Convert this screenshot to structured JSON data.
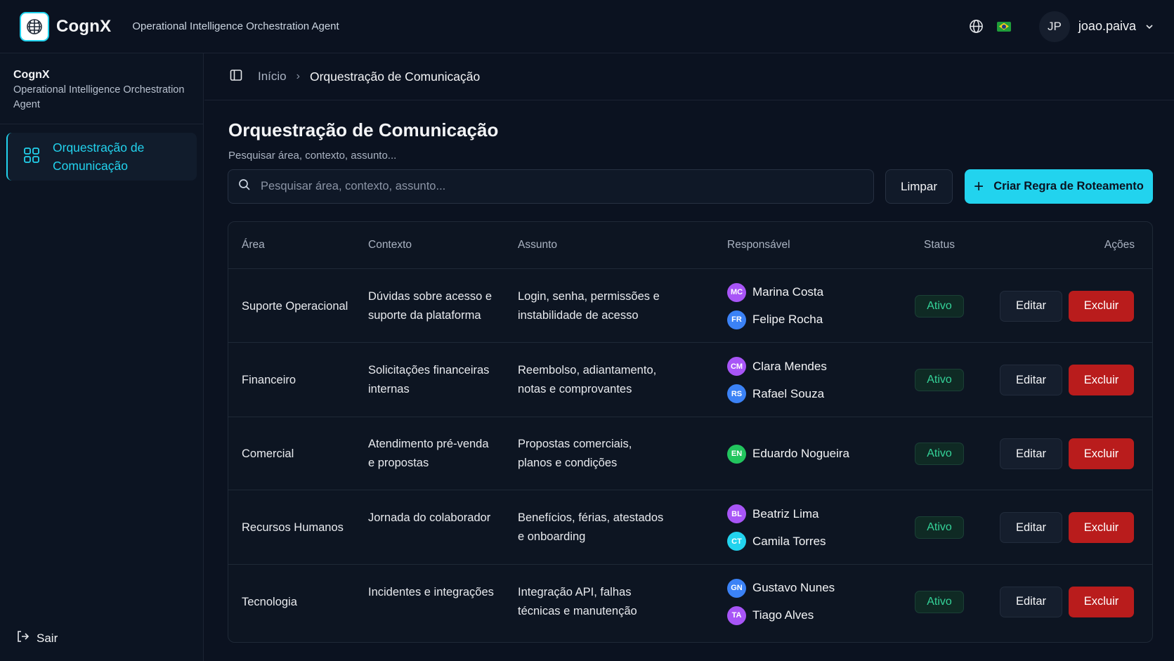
{
  "topbar": {
    "brand": "CognX",
    "tagline": "Operational Intelligence Orchestration Agent",
    "user_initials": "JP",
    "username": "joao.paiva"
  },
  "sidebar": {
    "title": "CognX",
    "subtitle": "Operational Intelligence Orchestration Agent",
    "items": [
      {
        "label": "Orquestração de Comunicação"
      }
    ],
    "logout_label": "Sair"
  },
  "breadcrumb": {
    "home": "Início",
    "current": "Orquestração de Comunicação"
  },
  "page": {
    "title": "Orquestração de Comunicação",
    "description": "Pesquisar área, contexto, assunto...",
    "search_placeholder": "Pesquisar área, contexto, assunto...",
    "clear_label": "Limpar",
    "create_label": "Criar Regra de Roteamento"
  },
  "table": {
    "headers": {
      "area": "Área",
      "context": "Contexto",
      "subject": "Assunto",
      "responsible": "Responsável",
      "status": "Status",
      "actions": "Ações"
    },
    "edit_label": "Editar",
    "delete_label": "Excluir",
    "rows": [
      {
        "area": "Suporte Operacional",
        "context": "Dúvidas sobre acesso e suporte da plataforma",
        "subject": "Login, senha, permissões e instabilidade de acesso",
        "people": [
          {
            "initials": "MC",
            "name": "Marina Costa",
            "color": "#a855f7"
          },
          {
            "initials": "FR",
            "name": "Felipe Rocha",
            "color": "#3b82f6"
          }
        ],
        "status": "Ativo"
      },
      {
        "area": "Financeiro",
        "context": "Solicitações financeiras internas",
        "subject": "Reembolso, adiantamento, notas e comprovantes",
        "people": [
          {
            "initials": "CM",
            "name": "Clara Mendes",
            "color": "#a855f7"
          },
          {
            "initials": "RS",
            "name": "Rafael Souza",
            "color": "#3b82f6"
          }
        ],
        "status": "Ativo"
      },
      {
        "area": "Comercial",
        "context": "Atendimento pré-venda e propostas",
        "subject": "Propostas comerciais, planos e condições",
        "people": [
          {
            "initials": "EN",
            "name": "Eduardo Nogueira",
            "color": "#22c55e"
          }
        ],
        "status": "Ativo"
      },
      {
        "area": "Recursos Humanos",
        "context": "Jornada do colaborador",
        "subject": "Benefícios, férias, atestados e onboarding",
        "people": [
          {
            "initials": "BL",
            "name": "Beatriz Lima",
            "color": "#a855f7"
          },
          {
            "initials": "CT",
            "name": "Camila Torres",
            "color": "#22d3ee"
          }
        ],
        "status": "Ativo"
      },
      {
        "area": "Tecnologia",
        "context": "Incidentes e integrações",
        "subject": "Integração API, falhas técnicas e manutenção",
        "people": [
          {
            "initials": "GN",
            "name": "Gustavo Nunes",
            "color": "#3b82f6"
          },
          {
            "initials": "TA",
            "name": "Tiago Alves",
            "color": "#a855f7"
          }
        ],
        "status": "Ativo"
      }
    ]
  },
  "colors": {
    "accent": "#22d3ee",
    "danger": "#b91c1c",
    "success": "#34d399",
    "background": "#0b1220"
  }
}
